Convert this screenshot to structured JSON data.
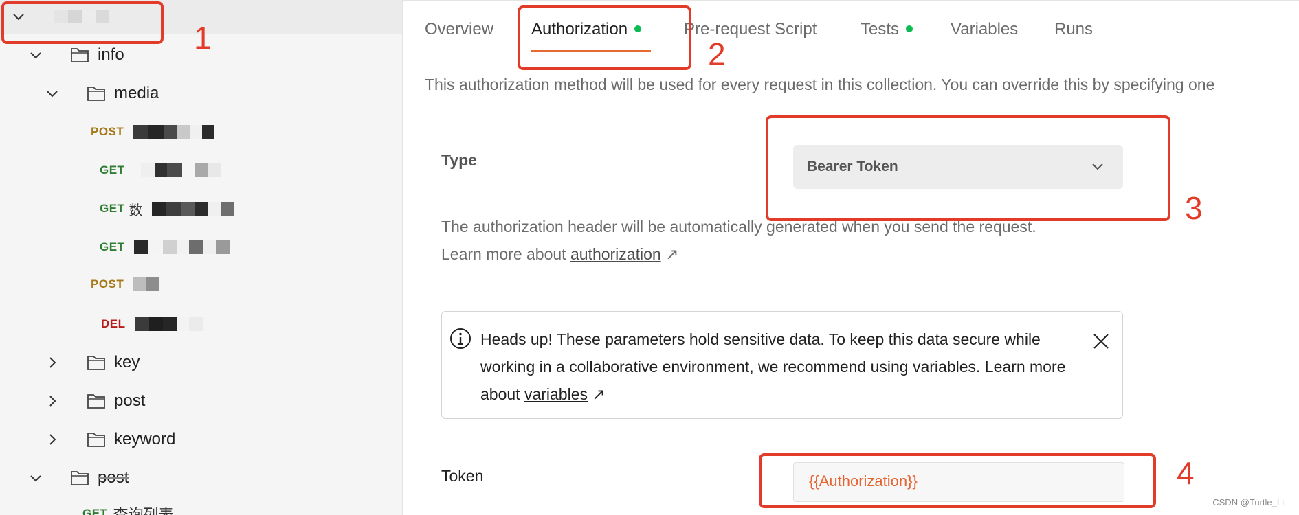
{
  "sidebar": {
    "folders": [
      {
        "label": "info",
        "state": "expanded"
      },
      {
        "label": "media",
        "state": "expanded"
      },
      {
        "label": "key",
        "state": "collapsed"
      },
      {
        "label": "post",
        "state": "collapsed"
      },
      {
        "label": "keyword",
        "state": "collapsed"
      },
      {
        "label": "post",
        "state": "expanded"
      }
    ],
    "requests": [
      {
        "method": "POST"
      },
      {
        "method": "GET"
      },
      {
        "method": "GET",
        "label": "数"
      },
      {
        "method": "GET"
      },
      {
        "method": "POST"
      },
      {
        "method": "DEL"
      },
      {
        "method": "GET",
        "label": "查询列表"
      }
    ]
  },
  "tabs": [
    {
      "label": "Overview",
      "dot": false,
      "active": false
    },
    {
      "label": "Authorization",
      "dot": true,
      "active": true
    },
    {
      "label": "Pre-request Script",
      "dot": false,
      "active": false
    },
    {
      "label": "Tests",
      "dot": true,
      "active": false
    },
    {
      "label": "Variables",
      "dot": false,
      "active": false
    },
    {
      "label": "Runs",
      "dot": false,
      "active": false
    }
  ],
  "auth": {
    "description": "This authorization method will be used for every request in this collection. You can override this by specifying one",
    "type_label": "Type",
    "type_value": "Bearer Token",
    "help_text": "The authorization header will be automatically generated when you send the request. Learn more about",
    "help_link": "authorization",
    "help_arrow": "↗"
  },
  "alert": {
    "text": "Heads up! These parameters hold sensitive data. To keep this data secure while working in a collaborative environment, we recommend using variables. Learn more about",
    "link": "variables",
    "arrow": "↗"
  },
  "token": {
    "label": "Token",
    "value": "{{Authorization}}"
  },
  "annotations": [
    "1",
    "2",
    "3",
    "4"
  ],
  "watermark": "CSDN @Turtle_Li",
  "colors": {
    "accent": "#e86a33",
    "annotation": "#e33b2a",
    "status_dot": "#0cbb52",
    "post": "#a6791a",
    "get": "#2f7d32",
    "del": "#b71c1c"
  }
}
